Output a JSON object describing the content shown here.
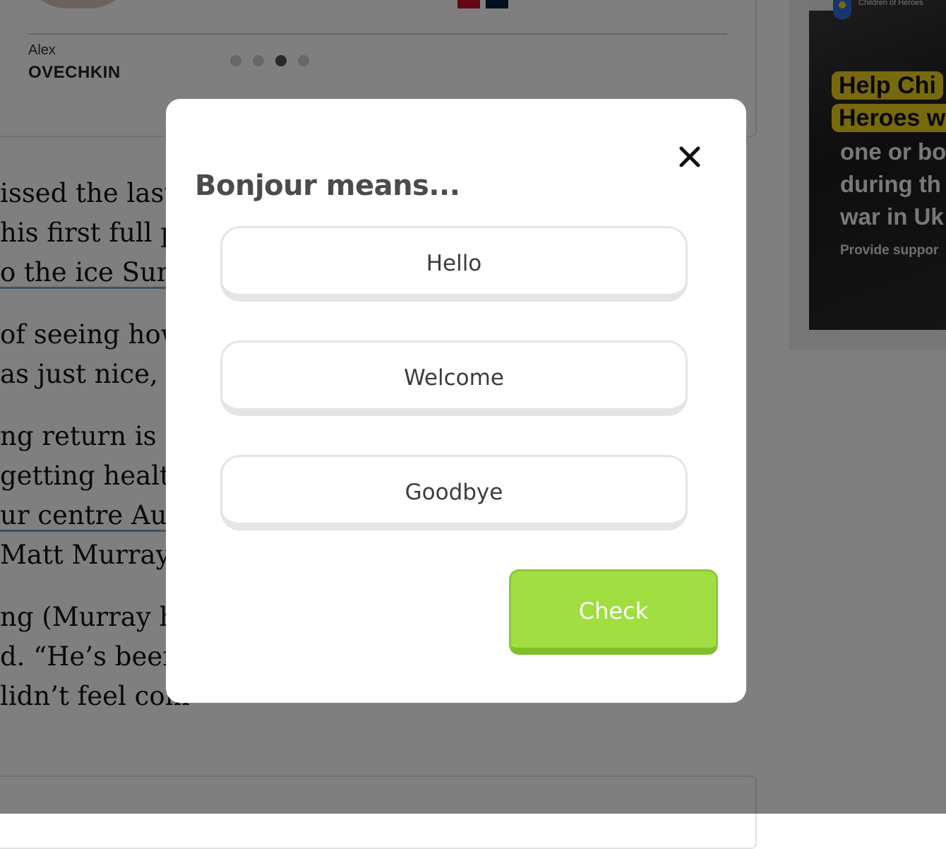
{
  "background": {
    "player": {
      "first_name": "Alex",
      "last_name": "OVECHKIN",
      "carousel_pages": 4,
      "carousel_active_index": 3
    },
    "article_paragraphs": [
      [
        "issed the last ",
        "his first full pra",
        "o the ice Sund"
      ],
      [
        "of seeing how ",
        "as just nice, an"
      ],
      [
        "ng return is a p",
        "getting healthy",
        "ur centre Austo",
        "Matt Murray (a"
      ],
      [
        "ng (Murray ha",
        "d. “He’s been g",
        "lidn’t feel com"
      ]
    ],
    "ad": {
      "org_name": "Children of Heroes",
      "headline_line1": "Help Chi",
      "headline_line2": "Heroes w",
      "body_line1": "one or bo",
      "body_line2": "during th",
      "body_line3": "war in Uk",
      "cta": "Provide suppor"
    }
  },
  "modal": {
    "question": "Bonjour means...",
    "close_label": "×",
    "options": [
      "Hello",
      "Welcome",
      "Goodbye"
    ],
    "check_label": "Check",
    "check_color": "#a0de42"
  }
}
